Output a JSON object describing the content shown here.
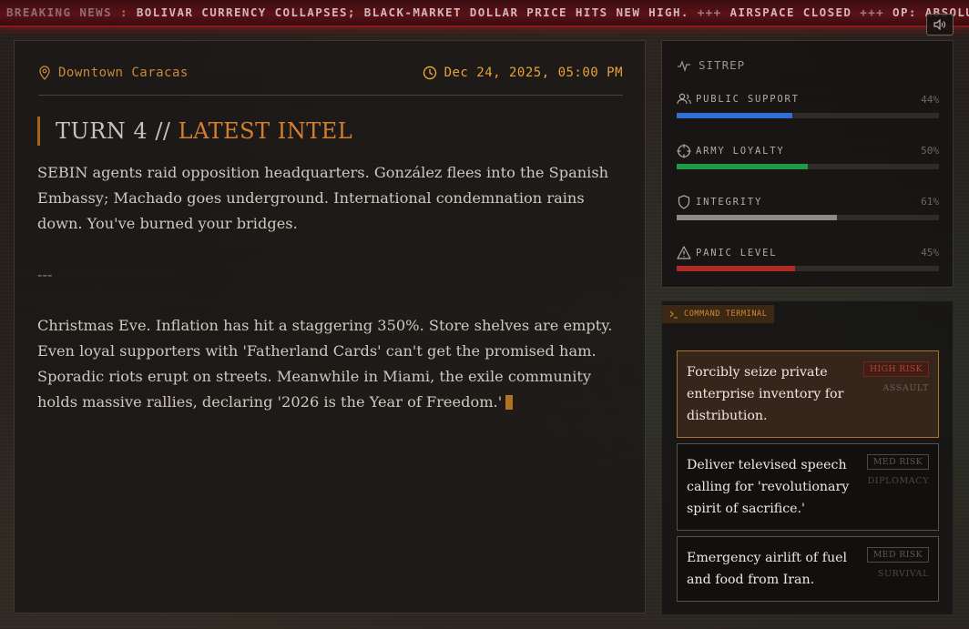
{
  "ticker": {
    "label": "BREAKING NEWS",
    "items": [
      "BOLIVAR CURRENCY COLLAPSES; BLACK-MARKET DOLLAR PRICE HITS NEW HIGH.",
      "AIRSPACE CLOSED",
      "OP: ABSOLUTE RESOLVE"
    ],
    "separator_1": ":",
    "separator": "+++"
  },
  "header": {
    "location": "Downtown Caracas",
    "datetime": "Dec 24, 2025, 05:00 PM"
  },
  "turn": {
    "prefix": "TURN 4 //",
    "title": "LATEST INTEL"
  },
  "story": {
    "paragraph_1": "SEBIN agents raid opposition headquarters. González flees into the Spanish Embassy; Machado goes underground. International condemnation rains down. You've burned your bridges.",
    "separator": "---",
    "paragraph_2": "Christmas Eve. Inflation has hit a staggering 350%. Store shelves are empty. Even loyal supporters with 'Fatherland Cards' can't get the promised ham. Sporadic riots erupt on streets. Meanwhile in Miami, the exile community holds massive rallies, declaring '2026 is the Year of Freedom.'"
  },
  "sitrep": {
    "title": "SITREP",
    "stats": [
      {
        "label": "PUBLIC SUPPORT",
        "value": 44,
        "display": "44%",
        "color": "#2f6fd6",
        "icon": "people-icon"
      },
      {
        "label": "ARMY LOYALTY",
        "value": 50,
        "display": "50%",
        "color": "#1f9a47",
        "icon": "crosshair-icon"
      },
      {
        "label": "INTEGRITY",
        "value": 61,
        "display": "61%",
        "color": "#8e8a86",
        "icon": "shield-icon"
      },
      {
        "label": "PANIC LEVEL",
        "value": 45,
        "display": "45%",
        "color": "#b02a26",
        "icon": "warning-icon"
      }
    ]
  },
  "terminal": {
    "title": "COMMAND TERMINAL",
    "choices": [
      {
        "text": "Forcibly seize private enterprise inventory for distribution.",
        "risk": "HIGH RISK",
        "category": "ASSAULT",
        "active": true
      },
      {
        "text": "Deliver televised speech calling for 'revolutionary spirit of sacrifice.'",
        "risk": "MED RISK",
        "category": "DIPLOMACY",
        "active": false
      },
      {
        "text": "Emergency airlift of fuel and food from Iran.",
        "risk": "MED RISK",
        "category": "SURVIVAL",
        "active": false
      }
    ]
  },
  "colors": {
    "accent": "#d2802f",
    "ticker_bg": "#5a1216"
  }
}
